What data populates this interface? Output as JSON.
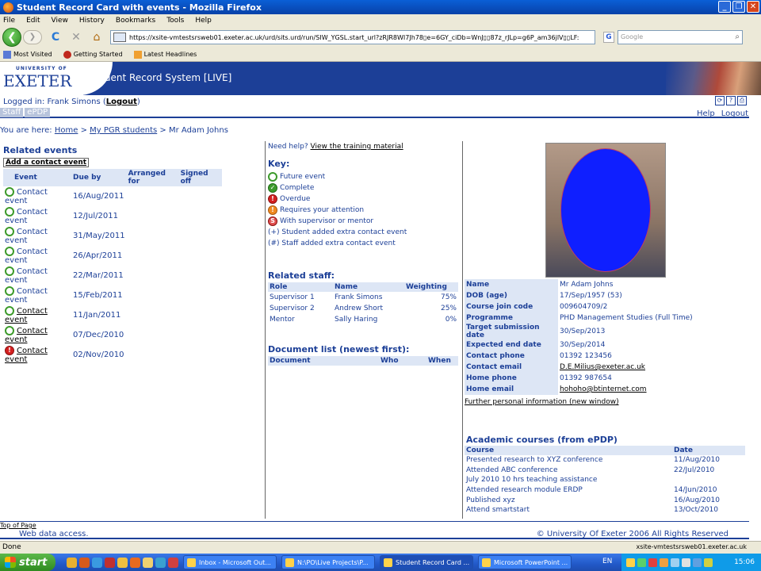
{
  "window": {
    "title": "Student Record Card with events - Mozilla Firefox",
    "minimize": "_",
    "restore": "❐",
    "close": "✕"
  },
  "menubar": [
    "File",
    "Edit",
    "View",
    "History",
    "Bookmarks",
    "Tools",
    "Help"
  ],
  "navbar": {
    "back": "❮",
    "forward": "❯",
    "reload": "C",
    "stop": "✕",
    "home": "⌂",
    "url": "https://xsite-vmtestsrsweb01.exeter.ac.uk/urd/sits.urd/run/SIW_YGSL.start_url?zRJR8WI7Jh78▯e=6GY_ciDb=WnJ▯▯87z_rJLp=g6P_am36jlV▯▯LF:",
    "search_placeholder": "Google",
    "search_engine": "G"
  },
  "bookmarks": [
    "Most Visited",
    "Getting Started",
    "Latest Headlines"
  ],
  "banner": {
    "logo_small": "UNIVERSITY OF",
    "logo_main": "EXETER",
    "title": "Student Record System [LIVE]"
  },
  "header": {
    "logged_in_prefix": "Logged in: Frank Simons (",
    "logout_label": "Logout",
    "logged_in_suffix": ")",
    "tabs": [
      "Staff",
      "ePDP"
    ],
    "help_link": "Help",
    "logout_link": "Logout",
    "icons": [
      "⟳",
      "?",
      "⎙"
    ]
  },
  "breadcrumb": {
    "prefix": "You are here:",
    "home": "Home",
    "sep1": ">",
    "students": "My PGR students",
    "sep2": ">",
    "current": "Mr Adam Johns"
  },
  "events": {
    "heading": "Related events",
    "add_link": "Add a contact event",
    "columns": [
      "Event",
      "Due by",
      "Arranged for",
      "Signed off"
    ],
    "rows": [
      {
        "status": "future",
        "event": "Contact event",
        "due": "16/Aug/2011",
        "underline": false
      },
      {
        "status": "future",
        "event": "Contact event",
        "due": "12/Jul/2011",
        "underline": false
      },
      {
        "status": "future",
        "event": "Contact event",
        "due": "31/May/2011",
        "underline": false
      },
      {
        "status": "future",
        "event": "Contact event",
        "due": "26/Apr/2011",
        "underline": false
      },
      {
        "status": "future",
        "event": "Contact event",
        "due": "22/Mar/2011",
        "underline": false
      },
      {
        "status": "future",
        "event": "Contact event",
        "due": "15/Feb/2011",
        "underline": false
      },
      {
        "status": "future",
        "event": "Contact event",
        "due": "11/Jan/2011",
        "underline": true
      },
      {
        "status": "future",
        "event": "Contact event",
        "due": "07/Dec/2010",
        "underline": true
      },
      {
        "status": "overdue",
        "event": "Contact event",
        "due": "02/Nov/2010",
        "underline": true
      }
    ]
  },
  "help": {
    "prefix": "Need help?",
    "link": "View the training material"
  },
  "key": {
    "heading": "Key:",
    "items": [
      {
        "status": "future",
        "label": "Future event"
      },
      {
        "status": "complete",
        "label": "Complete"
      },
      {
        "status": "overdue",
        "label": "Overdue"
      },
      {
        "status": "attention",
        "label": "Requires your attention"
      },
      {
        "status": "supervisor",
        "label": "With supervisor or mentor"
      },
      {
        "status": "",
        "label": "(+) Student added extra contact event"
      },
      {
        "status": "",
        "label": "(#) Staff added extra contact event"
      }
    ]
  },
  "staff": {
    "heading": "Related staff:",
    "columns": [
      "Role",
      "Name",
      "Weighting"
    ],
    "rows": [
      {
        "role": "Supervisor 1",
        "name": "Frank Simons",
        "weighting": "75%"
      },
      {
        "role": "Supervisor 2",
        "name": "Andrew Short",
        "weighting": "25%"
      },
      {
        "role": "Mentor",
        "name": "Sally Haring",
        "weighting": "0%"
      }
    ]
  },
  "documents": {
    "heading": "Document list (newest first):",
    "columns": [
      "Document",
      "Who",
      "When"
    ]
  },
  "student": {
    "details": [
      {
        "label": "Name",
        "value": "Mr Adam Johns",
        "link": false
      },
      {
        "label": "DOB (age)",
        "value": "17/Sep/1957 (53)",
        "link": false
      },
      {
        "label": "Course join code",
        "value": "009604709/2",
        "link": false
      },
      {
        "label": "Programme",
        "value": "PHD Management Studies (Full Time)",
        "link": false
      },
      {
        "label": "Target submission date",
        "value": "30/Sep/2013",
        "link": false
      },
      {
        "label": "Expected end date",
        "value": "30/Sep/2014",
        "link": false
      },
      {
        "label": "Contact phone",
        "value": "01392 123456",
        "link": false
      },
      {
        "label": "Contact email",
        "value": "D.E.Milius@exeter.ac.uk",
        "link": true
      },
      {
        "label": "Home phone",
        "value": "01392 987654",
        "link": false
      },
      {
        "label": "Home email",
        "value": "hohoho@btinternet.com",
        "link": true
      }
    ],
    "further_link": "Further personal information (new window)"
  },
  "courses": {
    "heading": "Academic courses (from ePDP)",
    "columns": [
      "Course",
      "Date"
    ],
    "rows": [
      {
        "course": "Presented research to XYZ conference",
        "date": "11/Aug/2010"
      },
      {
        "course": "Attended ABC conference",
        "date": "22/Jul/2010"
      },
      {
        "course": "July 2010 10 hrs teaching assistance",
        "date": ""
      },
      {
        "course": "Attended research module ERDP",
        "date": "14/Jun/2010"
      },
      {
        "course": "Published xyz",
        "date": "16/Aug/2010"
      },
      {
        "course": "Attend smartstart",
        "date": "13/Oct/2010"
      }
    ]
  },
  "footer": {
    "top_of_page": "Top of Page",
    "left": "Web data access.",
    "right": "© University Of Exeter 2006 All Rights Reserved"
  },
  "statusbar": {
    "left": "Done",
    "right": "xsite-vmtestsrsweb01.exeter.ac.uk"
  },
  "taskbar": {
    "start": "start",
    "buttons": [
      "Inbox - Microsoft Out...",
      "N:\\PO\\Live Projects\\P...",
      "Student Record Card ...",
      "Microsoft PowerPoint ..."
    ],
    "active_index": 2,
    "lang": "EN",
    "clock": "15:06"
  },
  "colors": {
    "brand": "#1c3f97",
    "header_cell": "#dde6f5",
    "future": "#3c9a2a",
    "overdue": "#d42020"
  }
}
